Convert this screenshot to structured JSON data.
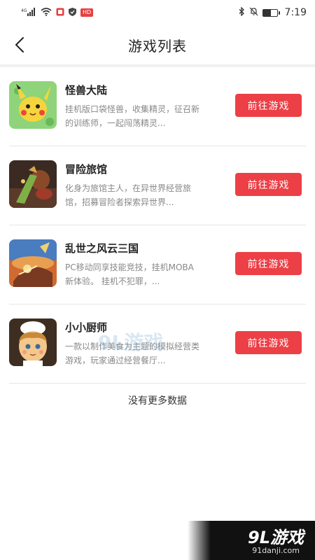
{
  "status_bar": {
    "signal": "4G",
    "net_badge": "HD",
    "time": "7:19",
    "battery_level": 0.55
  },
  "nav": {
    "title": "游戏列表",
    "back_icon": "chevron-left-icon"
  },
  "games": [
    {
      "name": "怪兽大陆",
      "desc": "挂机版口袋怪兽，收集精灵，征召新的训练师，一起闯荡精灵...",
      "button": "前往游戏",
      "thumb_colors": [
        "#7ec86a",
        "#f5d33a"
      ]
    },
    {
      "name": "冒险旅馆",
      "desc": "化身为旅馆主人，在异世界经营旅馆，招募冒险者探索异世界...",
      "button": "前往游戏",
      "thumb_colors": [
        "#3a2a22",
        "#c9a042"
      ]
    },
    {
      "name": "乱世之风云三国",
      "desc": "PC移动同享技能竞技，挂机MOBA新体验。 挂机不犯罪，...",
      "button": "前往游戏",
      "thumb_colors": [
        "#c85a2a",
        "#3a6fb0"
      ]
    },
    {
      "name": "小小厨师",
      "desc": "一款以制作美食为主题的模拟经营类游戏，玩家通过经营餐厅...",
      "button": "前往游戏",
      "thumb_colors": [
        "#4a3a2a",
        "#f3e3c8"
      ]
    }
  ],
  "footer": {
    "no_more": "没有更多数据"
  },
  "watermark": {
    "mid": "9L游戏",
    "brand": "9L游戏",
    "url": "91danji.com"
  },
  "colors": {
    "button_bg": "#ec3f46",
    "divider": "#e6e6e6"
  }
}
